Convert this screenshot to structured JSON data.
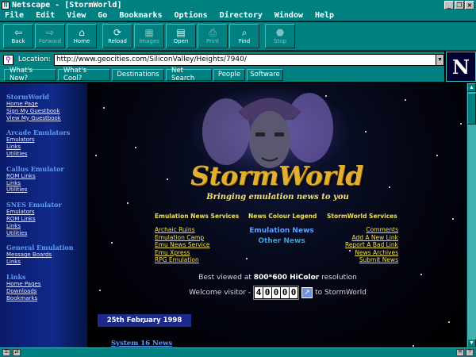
{
  "window": {
    "title": "Netscape - [StormWorld]",
    "controls": [
      "_",
      "❐",
      "×"
    ]
  },
  "menu": [
    "File",
    "Edit",
    "View",
    "Go",
    "Bookmarks",
    "Options",
    "Directory",
    "Window",
    "Help"
  ],
  "toolbar": [
    {
      "label": "Back",
      "icon": "back-arrow-icon",
      "glyph": "⇦"
    },
    {
      "label": "Forward",
      "icon": "forward-arrow-icon",
      "glyph": "⇨"
    },
    {
      "label": "Home",
      "icon": "home-icon",
      "glyph": "⌂"
    },
    {
      "label": "Reload",
      "icon": "reload-icon",
      "glyph": "⟳"
    },
    {
      "label": "Images",
      "icon": "images-icon",
      "glyph": "▦"
    },
    {
      "label": "Open",
      "icon": "open-icon",
      "glyph": "▤"
    },
    {
      "label": "Print",
      "icon": "print-icon",
      "glyph": "⎙"
    },
    {
      "label": "Find",
      "icon": "find-icon",
      "glyph": "⌕"
    },
    {
      "label": "Stop",
      "icon": "stop-icon",
      "glyph": "⬣"
    }
  ],
  "location": {
    "label": "Location:",
    "url": "http://www.geocities.com/SiliconValley/Heights/7940/"
  },
  "directory_buttons": [
    "What's New?",
    "What's Cool?",
    "Destinations",
    "Net Search",
    "People",
    "Software"
  ],
  "logo_letter": "N",
  "sidebar": [
    {
      "heading": "StormWorld",
      "links": [
        "Home Page",
        "Sign My Guestbook",
        "View My Guestbook"
      ]
    },
    {
      "heading": "Arcade Emulators",
      "links": [
        "Emulators",
        "Links",
        "Utilities"
      ]
    },
    {
      "heading": "Callus Emulator",
      "links": [
        "ROM Links",
        "Links",
        "Utilities"
      ]
    },
    {
      "heading": "SNES Emulator",
      "links": [
        "Emulators",
        "ROM Links",
        "Links",
        "Utilities"
      ]
    },
    {
      "heading": "General Emulation",
      "links": [
        "Message Boards",
        "Links"
      ]
    },
    {
      "heading": "Links",
      "links": [
        "Home Pages",
        "Downloads",
        "Bookmarks"
      ]
    }
  ],
  "main": {
    "logo_text": "StormWorld",
    "tagline": "Bringing emulation news to you",
    "col_left": {
      "heading": "Emulation News Services",
      "links": [
        "Archaic Ruins",
        "Emulation Camp",
        "Emu News Service",
        "Emu Xpress",
        "RPG Emulation"
      ]
    },
    "col_mid": {
      "heading": "News Colour Legend",
      "items": [
        {
          "label": "Emulation News",
          "color": "#5aa0ff"
        },
        {
          "label": "Other News",
          "color": "#3aa0e0"
        }
      ]
    },
    "col_right": {
      "heading": "StormWorld Services",
      "links": [
        "Comments",
        "Add A New Link",
        "Report A Bad Link",
        "News Archives",
        "Submit News"
      ]
    },
    "best_view_pre": "Best viewed at ",
    "best_view_res": "800*600 HiColor",
    "best_view_post": " resolution",
    "visitor_pre": "Welcome visitor -",
    "counter": [
      "4",
      "0",
      "0",
      "0",
      "0"
    ],
    "visitor_post": "to StormWorld",
    "date": "25th February 1998",
    "news_heading": "System 16 News"
  }
}
